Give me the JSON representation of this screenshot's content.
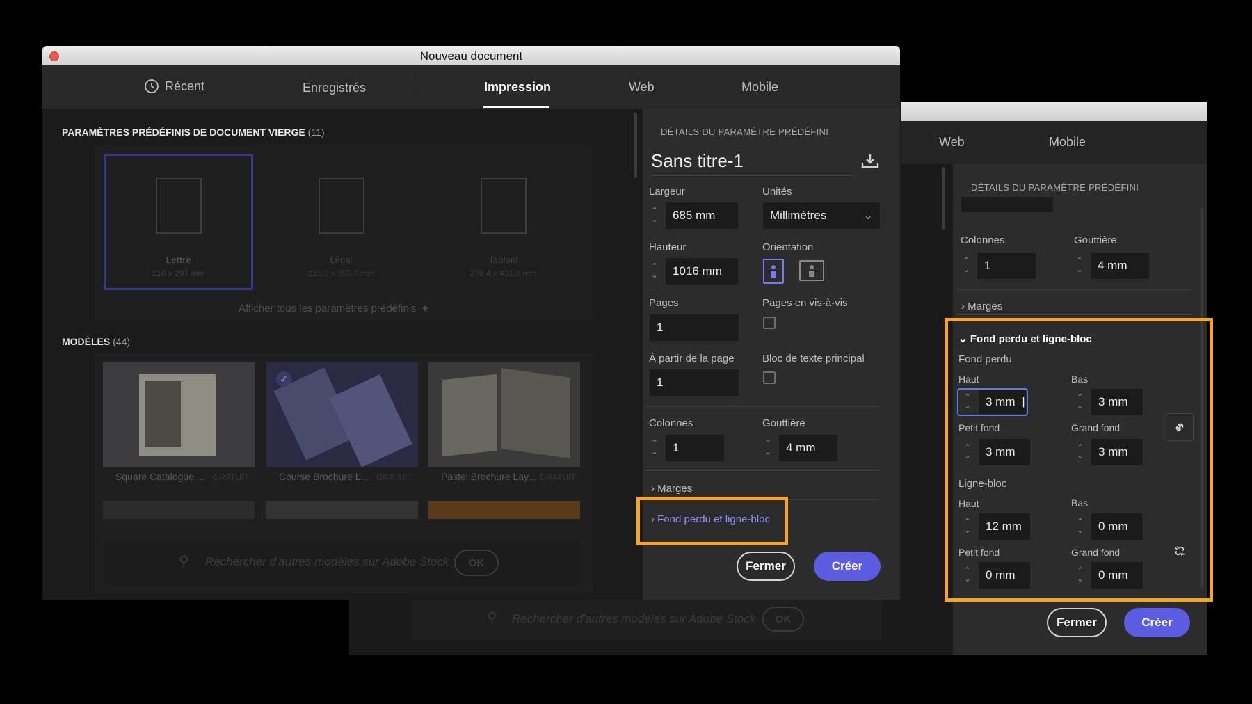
{
  "window": {
    "title": "Nouveau document"
  },
  "tabs": [
    {
      "label": "Récent",
      "icon": "clock-icon"
    },
    {
      "label": "Enregistrés"
    },
    {
      "label": "Impression",
      "active": true
    },
    {
      "label": "Web"
    },
    {
      "label": "Mobile"
    }
  ],
  "presets": {
    "heading": "PARAMÈTRES PRÉDÉFINIS DE DOCUMENT VIERGE",
    "count": "(11)",
    "items": [
      {
        "name": "Lettre",
        "size": "210 x 297 mm",
        "selected": true
      },
      {
        "name": "Légal",
        "size": "215,5 x 355,6 mm"
      },
      {
        "name": "Tabloïd",
        "size": "279,4 x 431,8 mm"
      }
    ],
    "show_all": "Afficher tous les paramètres prédéfinis",
    "show_all_icon": "plus-icon"
  },
  "templates": {
    "heading": "MODÈLES",
    "count": "(44)",
    "items": [
      {
        "name": "Square Catalogue ...",
        "badge": "GRATUIT"
      },
      {
        "name": "Course Brochure L...",
        "badge": "GRATUIT"
      },
      {
        "name": "Pastel Brochure Lay...",
        "badge": "GRATUIT"
      }
    ],
    "search_placeholder": "Rechercher d'autres modèles sur Adobe Stock",
    "search_ok": "OK"
  },
  "details": {
    "heading": "DÉTAILS DU PARAMÈTRE PRÉDÉFINI",
    "doc_name": "Sans titre-1",
    "largeur_label": "Largeur",
    "largeur": "685 mm",
    "unites_label": "Unités",
    "unites": "Millimètres",
    "hauteur_label": "Hauteur",
    "hauteur": "1016 mm",
    "orientation_label": "Orientation",
    "pages_label": "Pages",
    "pages": "1",
    "vis_a_vis_label": "Pages en vis-à-vis",
    "partir_label": "À partir de la page",
    "partir": "1",
    "bloc_label": "Bloc de texte principal",
    "colonnes_label": "Colonnes",
    "colonnes": "1",
    "gouttiere_label": "Gouttière",
    "gouttiere": "4 mm",
    "marges": "Marges",
    "fond_perdu_link": "Fond perdu et ligne-bloc",
    "fermer": "Fermer",
    "creer": "Créer"
  },
  "zoom": {
    "tabs": [
      "Web",
      "Mobile"
    ],
    "heading": "DÉTAILS DU PARAMÈTRE PRÉDÉFINI",
    "colonnes_label": "Colonnes",
    "colonnes": "1",
    "gouttiere_label": "Gouttière",
    "gouttiere": "4 mm",
    "marges": "Marges",
    "section": "Fond perdu et ligne-bloc",
    "fond_perdu": "Fond perdu",
    "fp_haut_label": "Haut",
    "fp_haut": "3 mm",
    "fp_bas_label": "Bas",
    "fp_bas": "3 mm",
    "fp_petit_label": "Petit fond",
    "fp_petit": "3 mm",
    "fp_grand_label": "Grand fond",
    "fp_grand": "3 mm",
    "ligne_bloc": "Ligne-bloc",
    "lb_haut_label": "Haut",
    "lb_haut": "12 mm",
    "lb_bas_label": "Bas",
    "lb_bas": "0 mm",
    "lb_petit_label": "Petit fond",
    "lb_petit": "0 mm",
    "lb_grand_label": "Grand fond",
    "lb_grand": "0 mm",
    "search_placeholder": "Rechercher d'autres modèles sur Adobe Stock",
    "search_ok": "OK",
    "fermer": "Fermer",
    "creer": "Créer"
  },
  "colors": {
    "highlight": "#f5a623",
    "accent": "#5c5ce0",
    "link": "#8f8fff"
  }
}
